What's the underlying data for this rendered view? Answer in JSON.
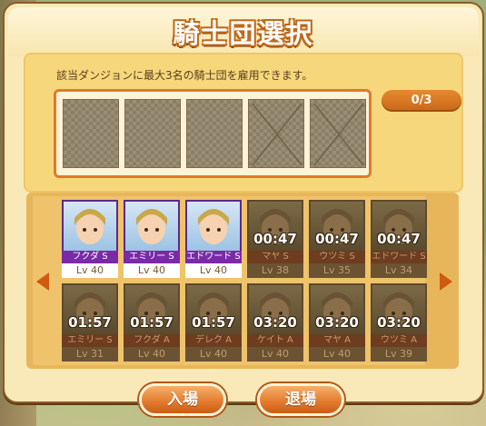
{
  "window": {
    "title": "騎士団選択",
    "description": "該当ダンジョンに最大3名の騎士団を雇用できます。",
    "counter": "0/3"
  },
  "slots": [
    {
      "state": "empty"
    },
    {
      "state": "empty"
    },
    {
      "state": "empty"
    },
    {
      "state": "unavailable"
    },
    {
      "state": "unavailable"
    }
  ],
  "roster": {
    "cards": [
      {
        "name": "フクダ S",
        "level": "Lv 40",
        "timer": "",
        "available": true
      },
      {
        "name": "エミリー S",
        "level": "Lv 40",
        "timer": "",
        "available": true
      },
      {
        "name": "エドワード S",
        "level": "Lv 40",
        "timer": "",
        "available": true
      },
      {
        "name": "マヤ S",
        "level": "Lv 38",
        "timer": "00:47",
        "available": false
      },
      {
        "name": "ウツミ S",
        "level": "Lv 35",
        "timer": "00:47",
        "available": false
      },
      {
        "name": "エドワード S",
        "level": "Lv 34",
        "timer": "00:47",
        "available": false
      },
      {
        "name": "エミリー S",
        "level": "Lv 31",
        "timer": "01:57",
        "available": false
      },
      {
        "name": "フクダ A",
        "level": "Lv 40",
        "timer": "01:57",
        "available": false
      },
      {
        "name": "デレク A",
        "level": "Lv 40",
        "timer": "01:57",
        "available": false
      },
      {
        "name": "ケイト A",
        "level": "Lv 40",
        "timer": "03:20",
        "available": false
      },
      {
        "name": "マヤ A",
        "level": "Lv 40",
        "timer": "03:20",
        "available": false
      },
      {
        "name": "ウツミ A",
        "level": "Lv 39",
        "timer": "03:20",
        "available": false
      }
    ]
  },
  "buttons": {
    "enter": "入場",
    "exit": "退場"
  },
  "icons": {
    "prev": "arrow-left-icon",
    "next": "arrow-right-icon"
  },
  "colors": {
    "accent": "#e07a2a",
    "active_label": "#7a2aa8",
    "panel": "#f6d77c"
  }
}
